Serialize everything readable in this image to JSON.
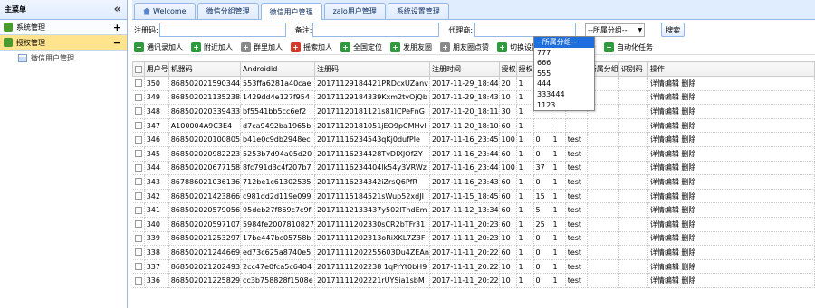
{
  "sidebar": {
    "title": "主菜单",
    "collapse_glyph": "«",
    "groups": [
      {
        "label": "系统管理",
        "toggle": "+"
      },
      {
        "label": "授权管理",
        "toggle": "−"
      }
    ],
    "items": [
      {
        "label": "微信用户管理"
      }
    ]
  },
  "tabs": [
    {
      "label": "Welcome"
    },
    {
      "label": "微信分组管理"
    },
    {
      "label": "微信用户管理"
    },
    {
      "label": "zalo用户管理"
    },
    {
      "label": "系统设置管理"
    }
  ],
  "filters": {
    "reg_label": "注册码:",
    "note_label": "备注:",
    "agent_label": "代理商:",
    "group_selected": "--所属分组--",
    "search_label": "搜索"
  },
  "toolbar": [
    {
      "label": "通讯录加人",
      "color": "#2e9b3c"
    },
    {
      "label": "附近加人",
      "color": "#2e9b3c"
    },
    {
      "label": "群里加人",
      "color": "#8a8a8a"
    },
    {
      "label": "摇索加人",
      "color": "#d23b2b"
    },
    {
      "label": "全国定位",
      "color": "#2e9b3c"
    },
    {
      "label": "发朋友圈",
      "color": "#2e9b3c"
    },
    {
      "label": "朋友圈点赞",
      "color": "#8a8a8a"
    },
    {
      "label": "切换设置",
      "color": "#2e9b3c"
    },
    {
      "label": "下一个账号",
      "color": "#d23b2b"
    },
    {
      "label": "自动化任务",
      "color": "#2e9b3c"
    }
  ],
  "columns": [
    "用户号",
    "机器码",
    "Androidid",
    "注册码",
    "注册时间",
    "授权",
    "授权",
    "是否",
    "",
    "",
    "所属分组",
    "识别码",
    "操作"
  ],
  "rows": [
    [
      "350",
      "868502021590344",
      "553ffa6281a40cae",
      "20171129184421PRDcxUZanv",
      "2017-11-29_18:44",
      "20",
      "1",
      "",
      "",
      "",
      "",
      "",
      "详情编辑 删除"
    ],
    [
      "349",
      "868502021135238",
      "1429dd4e127f954",
      "20171129184339Kxm2tvOjQb",
      "2017-11-29_18:43",
      "10",
      "1",
      "",
      "",
      "",
      "",
      "",
      "详情编辑 删除"
    ],
    [
      "348",
      "868502020339433",
      "bf5541bb5cc6ef2",
      "20171120181121s81ICPeFnG",
      "2017-11-20_18:11",
      "30",
      "1",
      "",
      "",
      "",
      "",
      "",
      "详情编辑 删除"
    ],
    [
      "347",
      "A100004A9C3E4",
      "d7ca9492ba1965b",
      "20171120181051jEO9pCMHvl",
      "2017-11-20_18:10",
      "60",
      "1",
      "",
      "",
      "",
      "",
      "",
      "详情编辑 删除"
    ],
    [
      "346",
      "868502020100805",
      "b41e0c9db2948ec",
      "20171116234543qKj0dufPle",
      "2017-11-16_23:45",
      "100",
      "1",
      "0",
      "1",
      "test",
      "",
      "",
      "详情编辑 删除"
    ],
    [
      "345",
      "868502020982223",
      "5253b7d94a05d20",
      "20171116234428TvDIXJOfZY",
      "2017-11-16_23:44",
      "60",
      "1",
      "0",
      "1",
      "test",
      "",
      "",
      "详情编辑 删除"
    ],
    [
      "344",
      "868502020677158",
      "8fc791d3c4f207b7",
      "20171116234404lk54y3VRWz",
      "2017-11-16_23:44",
      "100",
      "1",
      "37",
      "1",
      "test",
      "",
      "",
      "详情编辑 删除"
    ],
    [
      "343",
      "867886021036136",
      "712be1c61302535",
      "20171116234342iZrsQ6PfR",
      "2017-11-16_23:43",
      "60",
      "1",
      "0",
      "1",
      "test",
      "",
      "",
      "详情编辑 删除"
    ],
    [
      "342",
      "868502021423866",
      "c981dd2d119e099",
      "20171115184521sWup52xdJI",
      "2017-11-15_18:45",
      "60",
      "1",
      "15",
      "1",
      "test",
      "",
      "",
      "详情编辑 删除"
    ],
    [
      "341",
      "868502020579056",
      "95deb27f869c7c9f",
      "20171112133437y502lThdEm",
      "2017-11-12_13:34",
      "60",
      "1",
      "5",
      "1",
      "test",
      "",
      "",
      "详情编辑 删除"
    ],
    [
      "340",
      "868502020597107",
      "5984fe2007810827",
      "20171111202330sCR2bTFr31",
      "2017-11-11_20:23",
      "60",
      "1",
      "25",
      "1",
      "test",
      "",
      "",
      "详情编辑 删除"
    ],
    [
      "339",
      "868502021253297",
      "17be447bc05758b",
      "20171111202313oRiXKL7Z3F",
      "2017-11-11_20:23",
      "10",
      "1",
      "0",
      "1",
      "test",
      "",
      "",
      "详情编辑 删除"
    ],
    [
      "338",
      "868502021244669",
      "ed73c625a8740e5",
      "20171111202255603Du4ZEAn",
      "2017-11-11_20:22",
      "60",
      "1",
      "0",
      "1",
      "test",
      "",
      "",
      "详情编辑 删除"
    ],
    [
      "337",
      "868502021202493",
      "2cc47e0fca5c6404",
      "20171111202238 1qPrYt0bH9",
      "2017-11-11_20:22",
      "10",
      "1",
      "0",
      "1",
      "test",
      "",
      "",
      "详情编辑 删除"
    ],
    [
      "336",
      "868502021225829",
      "cc3b758828f1508e",
      "20171111202221rUYSia1sbM",
      "2017-11-11_20:22",
      "10",
      "1",
      "0",
      "1",
      "test",
      "",
      "",
      "详情编辑 删除"
    ]
  ],
  "group_options": [
    "--所属分组--",
    "777",
    "666",
    "555",
    "444",
    "333444",
    "1123"
  ]
}
